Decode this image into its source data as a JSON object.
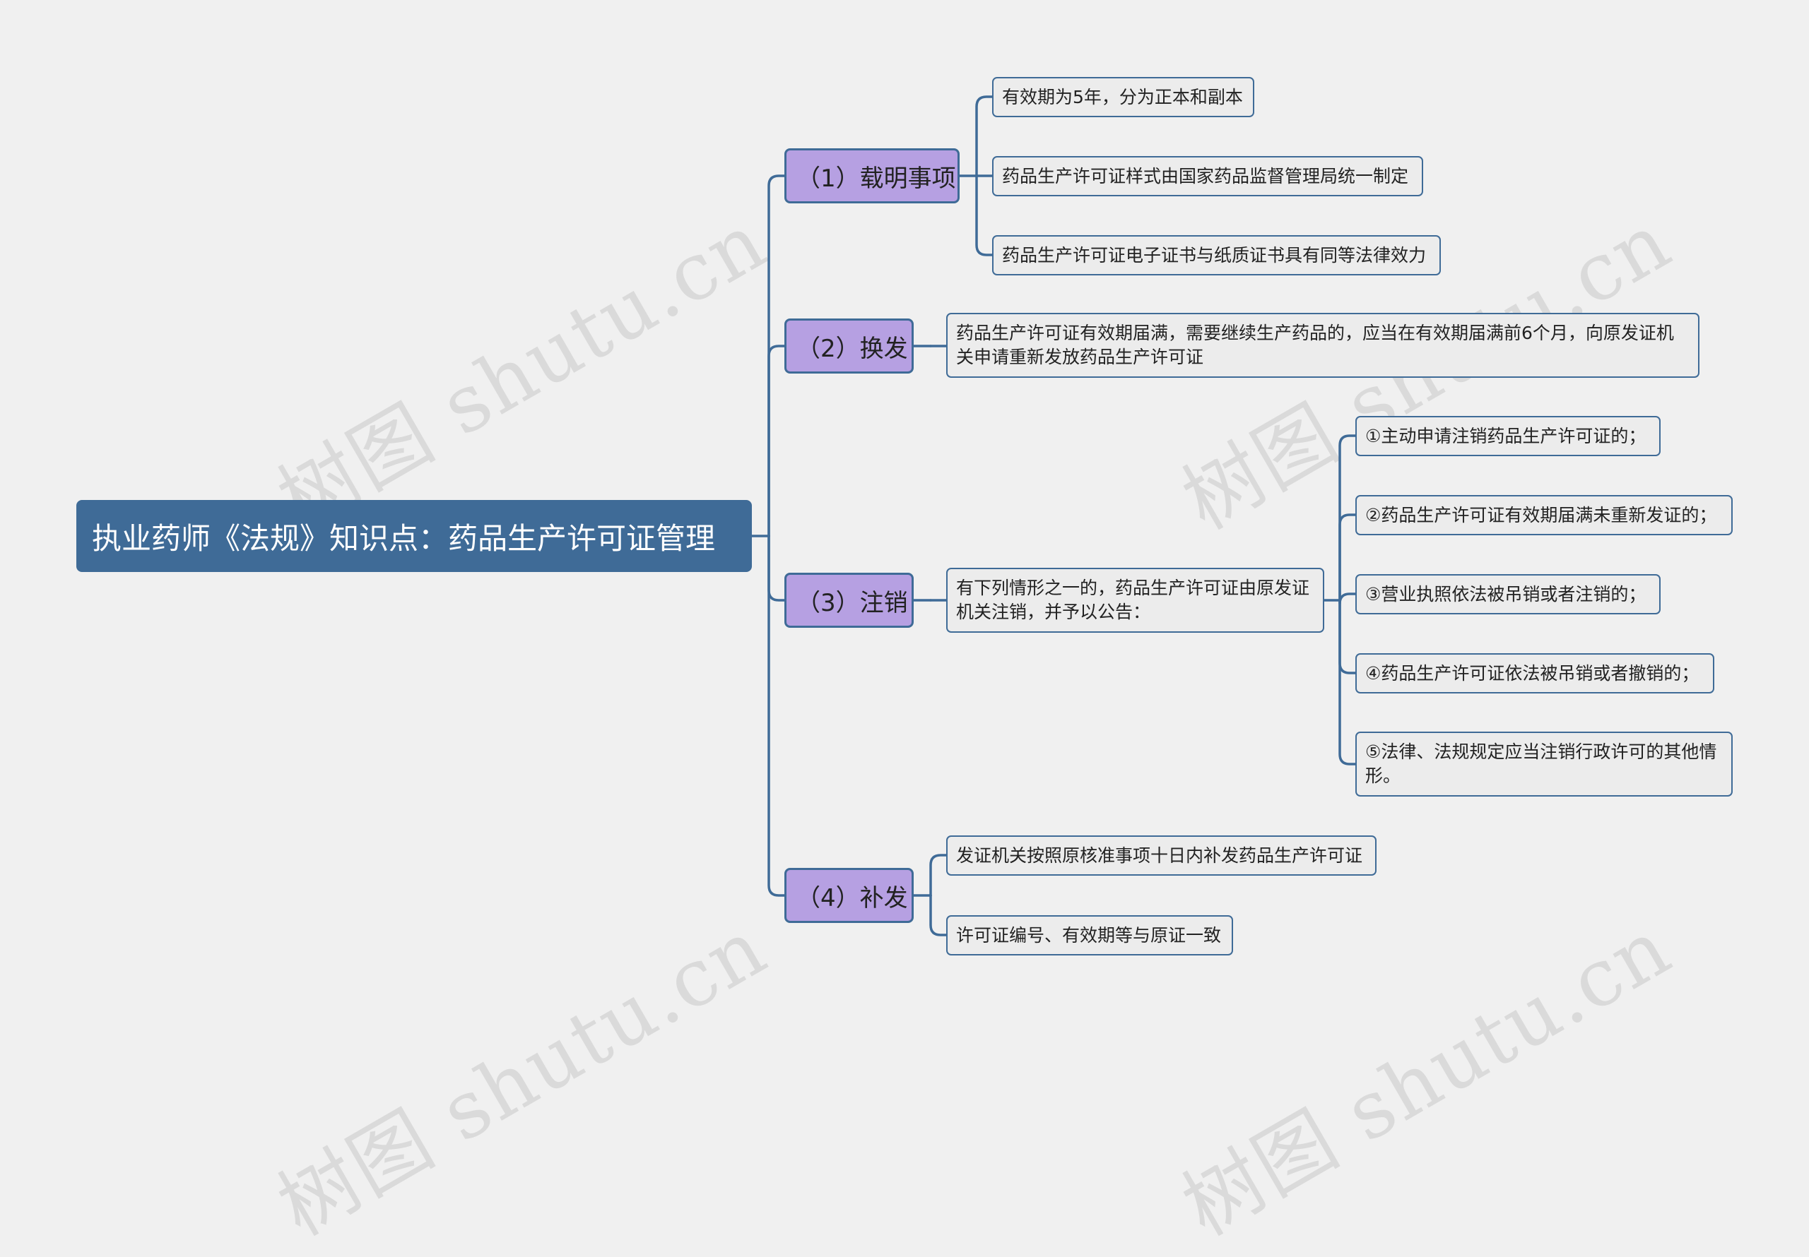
{
  "theme": {
    "background": "#f0f0f0",
    "root_fill": "#3f6b97",
    "branch_fill": "#b6a0e2",
    "line_color": "#3f6b97",
    "leaf_fill": "#ececec"
  },
  "watermark": {
    "text": "树图 shutu.cn"
  },
  "root": {
    "label": "执业药师《法规》知识点：药品生产许可证管理"
  },
  "branches": [
    {
      "label": "（1）载明事项",
      "items": [
        "有效期为5年，分为正本和副本",
        "药品生产许可证样式由国家药品监督管理局统一制定",
        "药品生产许可证电子证书与纸质证书具有同等法律效力"
      ]
    },
    {
      "label": "（2）换发",
      "items": [
        "药品生产许可证有效期届满，需要继续生产药品的，应当在有效期届满前6个月，向原发证机关申请重新发放药品生产许可证"
      ]
    },
    {
      "label": "（3）注销",
      "items": [
        "有下列情形之一的，药品生产许可证由原发证机关注销，并予以公告："
      ],
      "sub_items": [
        "①主动申请注销药品生产许可证的；",
        "②药品生产许可证有效期届满未重新发证的；",
        "③营业执照依法被吊销或者注销的；",
        "④药品生产许可证依法被吊销或者撤销的；",
        "⑤法律、法规规定应当注销行政许可的其他情形。"
      ]
    },
    {
      "label": "（4）补发",
      "items": [
        "发证机关按照原核准事项十日内补发药品生产许可证",
        "许可证编号、有效期等与原证一致"
      ]
    }
  ]
}
